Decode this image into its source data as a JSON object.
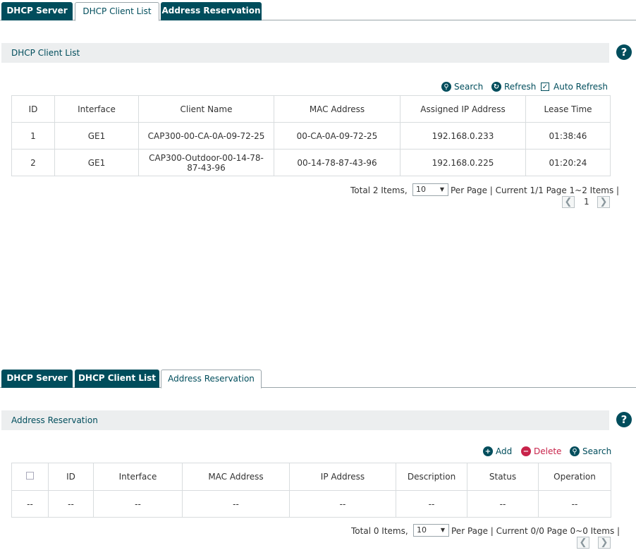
{
  "client_panel": {
    "tabs": [
      {
        "label": "DHCP Server",
        "active": false
      },
      {
        "label": "DHCP Client List",
        "active": true
      },
      {
        "label": "Address Reservation",
        "active": false
      }
    ],
    "section_title": "DHCP Client List",
    "help_icon": "?",
    "toolbar": {
      "search_label": "Search",
      "refresh_label": "Refresh",
      "auto_refresh_label": "Auto Refresh",
      "auto_refresh_checked": true
    },
    "columns": [
      "ID",
      "Interface",
      "Client Name",
      "MAC Address",
      "Assigned IP Address",
      "Lease Time"
    ],
    "rows": [
      {
        "id": "1",
        "interface": "GE1",
        "client_name": "CAP300-00-CA-0A-09-72-25",
        "mac": "00-CA-0A-09-72-25",
        "ip": "192.168.0.233",
        "lease": "01:38:46"
      },
      {
        "id": "2",
        "interface": "GE1",
        "client_name": "CAP300-Outdoor-00-14-78-87-43-96",
        "mac": "00-14-78-87-43-96",
        "ip": "192.168.0.225",
        "lease": "01:20:24"
      }
    ],
    "pager": {
      "total_text": "Total 2 Items,",
      "per_page_value": "10",
      "per_page_text": "Per Page | Current 1/1 Page 1~2 Items |",
      "page_number": "1"
    }
  },
  "reservation_panel": {
    "tabs": [
      {
        "label": "DHCP Server",
        "active": false
      },
      {
        "label": "DHCP Client List",
        "active": false
      },
      {
        "label": "Address Reservation",
        "active": true
      }
    ],
    "section_title": "Address Reservation",
    "help_icon": "?",
    "toolbar": {
      "add_label": "Add",
      "delete_label": "Delete",
      "search_label": "Search"
    },
    "columns": [
      "",
      "ID",
      "Interface",
      "MAC Address",
      "IP Address",
      "Description",
      "Status",
      "Operation"
    ],
    "rows": [
      {
        "cells": [
          "--",
          "--",
          "--",
          "--",
          "--",
          "--",
          "--",
          "--"
        ]
      }
    ],
    "pager": {
      "total_text": "Total 0 Items,",
      "per_page_value": "10",
      "per_page_text": "Per Page | Current 0/0 Page 0~0 Items |"
    }
  },
  "colors": {
    "tab_dark": "#004d5c",
    "section_bg": "#eceeef",
    "delete_red": "#c8234a"
  },
  "icons": {
    "help": "help-icon",
    "search": "search-icon",
    "refresh": "refresh-icon",
    "add": "plus-icon",
    "delete": "minus-icon",
    "prev": "chevron-left-icon",
    "next": "chevron-right-icon"
  }
}
